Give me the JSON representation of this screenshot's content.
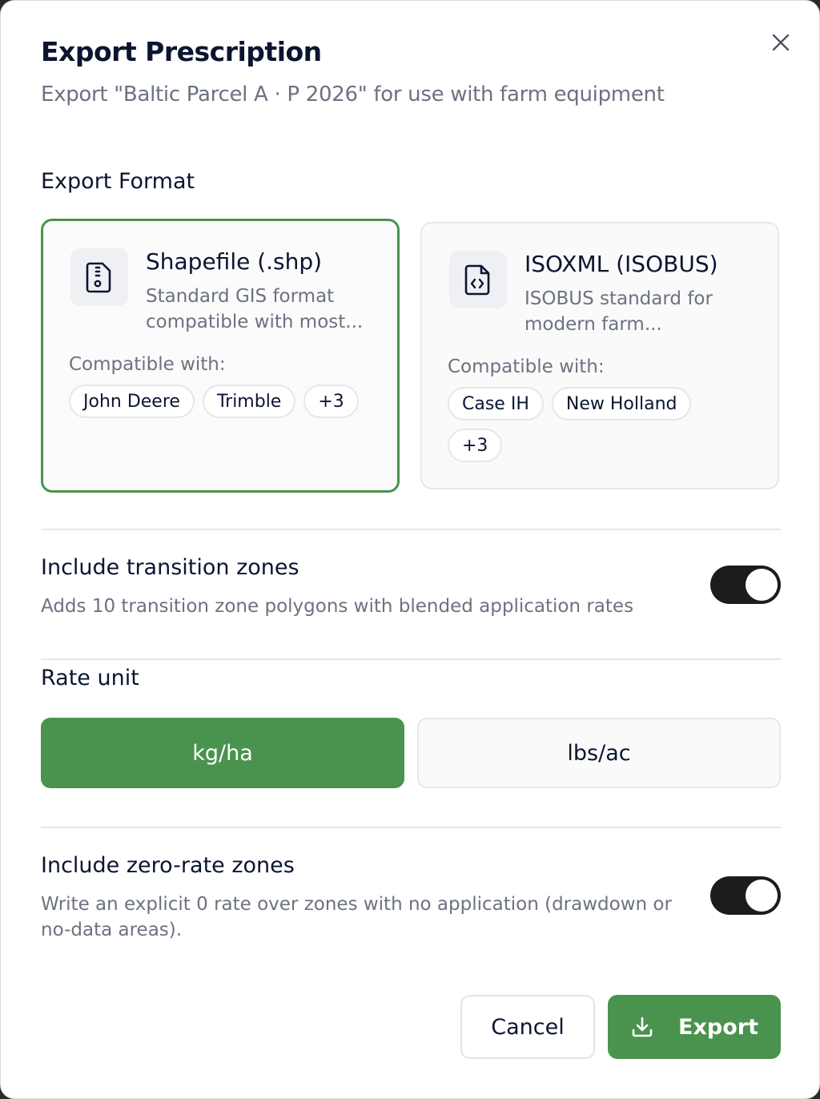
{
  "dialog": {
    "title": "Export Prescription",
    "subtitle": "Export \"Baltic Parcel A · P 2026\" for use with farm equipment",
    "close_icon": "close-icon"
  },
  "export_format": {
    "label": "Export Format",
    "options": [
      {
        "name": "Shapefile (.shp)",
        "description": "Standard GIS format compatible with most...",
        "icon": "file-shapefile-icon",
        "compat_label": "Compatible with:",
        "chips": [
          "John Deere",
          "Trimble",
          "+3"
        ],
        "selected": true
      },
      {
        "name": "ISOXML (ISOBUS)",
        "description": "ISOBUS standard for modern farm...",
        "icon": "file-code-icon",
        "compat_label": "Compatible with:",
        "chips": [
          "Case IH",
          "New Holland",
          "+3"
        ],
        "selected": false
      }
    ]
  },
  "transition_zones": {
    "title": "Include transition zones",
    "description": "Adds 10 transition zone polygons with blended application rates",
    "enabled": true
  },
  "rate_unit": {
    "label": "Rate unit",
    "options": [
      "kg/ha",
      "lbs/ac"
    ],
    "selected": "kg/ha"
  },
  "zero_rate_zones": {
    "title": "Include zero-rate zones",
    "description": "Write an explicit 0 rate over zones with no application (drawdown or no-data areas).",
    "enabled": true
  },
  "actions": {
    "cancel_label": "Cancel",
    "export_label": "Export",
    "export_icon": "download-icon"
  },
  "colors": {
    "accent": "#4a934e",
    "toggle_on": "#1c1c1c",
    "text_primary": "#0b1530",
    "text_muted": "#6b7280"
  }
}
